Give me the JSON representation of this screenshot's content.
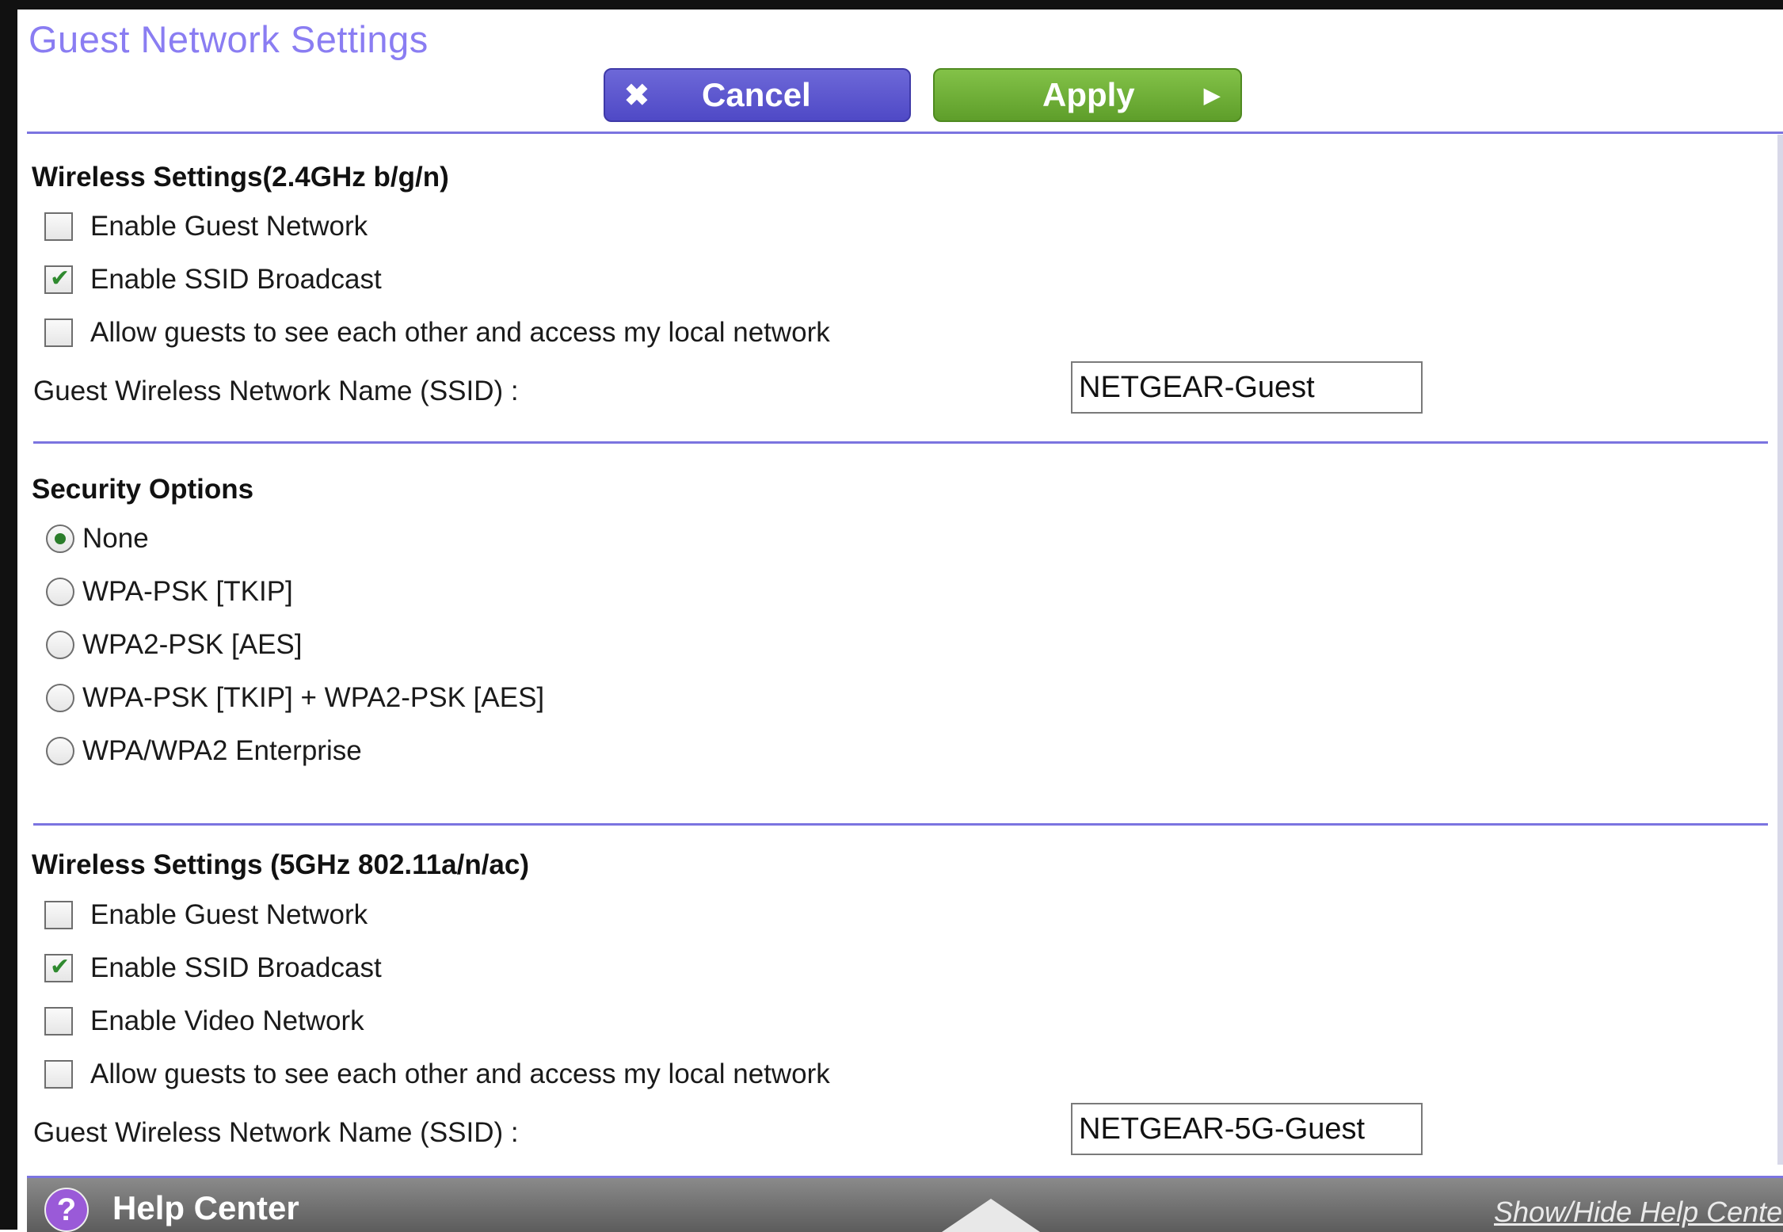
{
  "header": {
    "title": "Guest Network Settings",
    "cancel_label": "Cancel",
    "apply_label": "Apply"
  },
  "icons": {
    "cancel": "close-x-icon",
    "apply": "play-arrow-icon",
    "help": "question-mark-icon",
    "collapse": "up-triangle-icon"
  },
  "colors": {
    "title": "#8a7df2",
    "cancel_button": "#5a55cf",
    "apply_button": "#6fb03a",
    "divider": "#7b74e0",
    "help_bar": "#6f6f6f"
  },
  "wireless_24": {
    "title": "Wireless Settings(2.4GHz b/g/n)",
    "options": [
      {
        "label": "Enable Guest Network",
        "checked": false
      },
      {
        "label": "Enable SSID Broadcast",
        "checked": true
      },
      {
        "label": "Allow guests to see each other and access my local network",
        "checked": false
      }
    ],
    "ssid_label": "Guest Wireless Network Name (SSID) :",
    "ssid_value": "NETGEAR-Guest"
  },
  "security": {
    "title": "Security Options",
    "options": [
      {
        "label": "None",
        "selected": true
      },
      {
        "label": "WPA-PSK [TKIP]",
        "selected": false
      },
      {
        "label": "WPA2-PSK [AES]",
        "selected": false
      },
      {
        "label": "WPA-PSK [TKIP] + WPA2-PSK [AES]",
        "selected": false
      },
      {
        "label": "WPA/WPA2 Enterprise",
        "selected": false
      }
    ]
  },
  "wireless_5": {
    "title": "Wireless Settings (5GHz 802.11a/n/ac)",
    "options": [
      {
        "label": "Enable Guest Network",
        "checked": false
      },
      {
        "label": "Enable SSID Broadcast",
        "checked": true
      },
      {
        "label": "Enable Video Network",
        "checked": false
      },
      {
        "label": "Allow guests to see each other and access my local network",
        "checked": false
      }
    ],
    "ssid_label": "Guest Wireless Network Name (SSID) :",
    "ssid_value": "NETGEAR-5G-Guest"
  },
  "help": {
    "title": "Help Center",
    "link": "Show/Hide Help Center"
  }
}
